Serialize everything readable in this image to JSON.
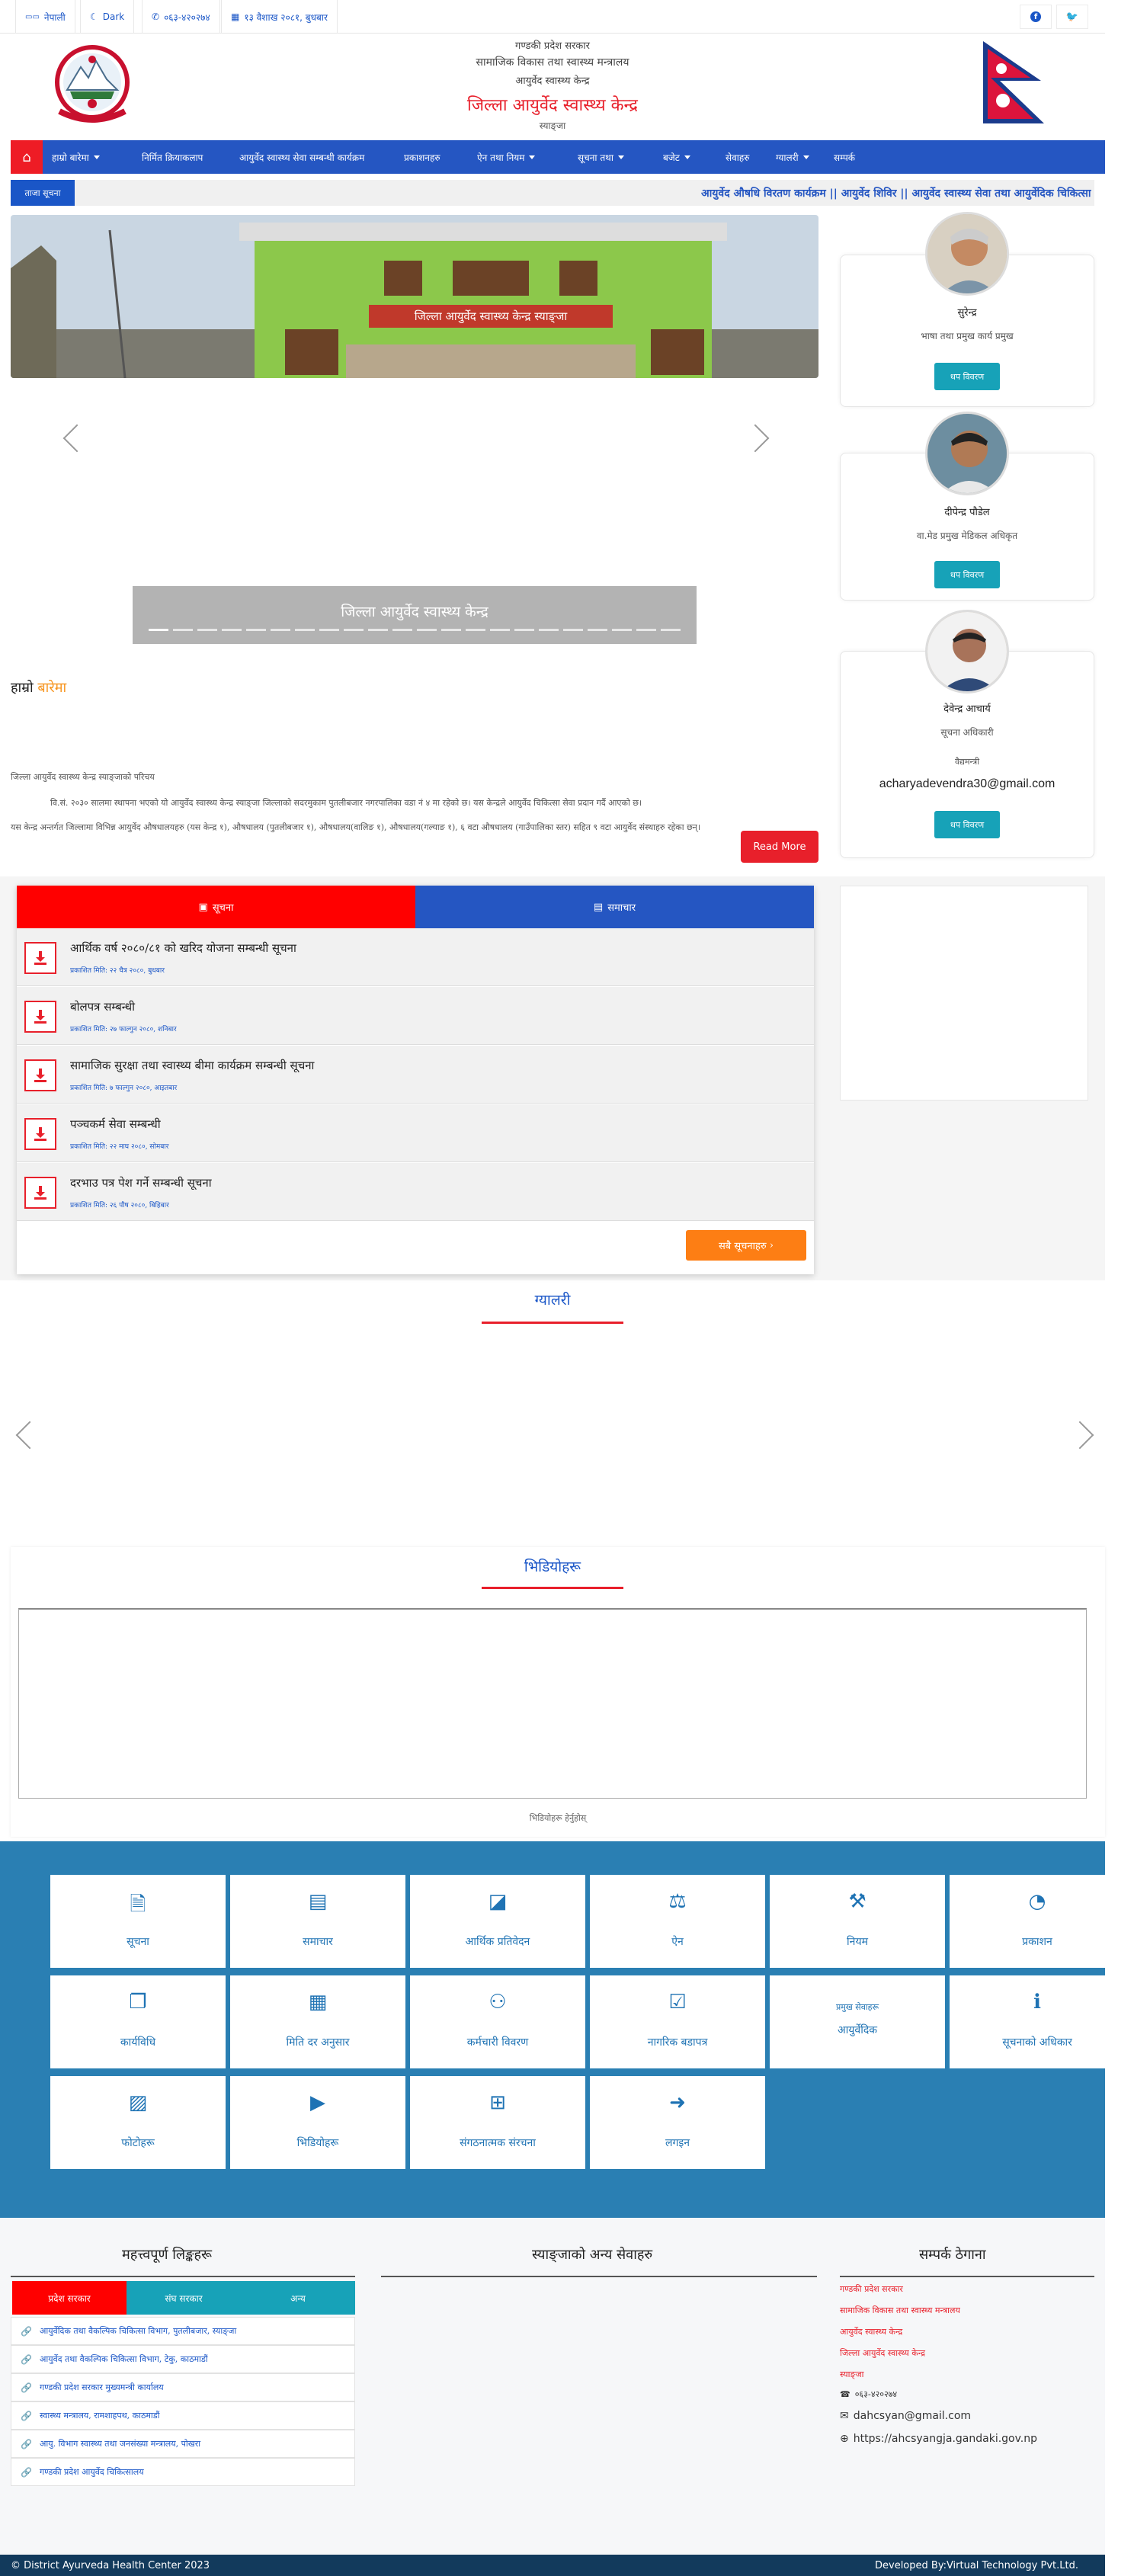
{
  "topbar": {
    "lang_label": "नेपाली",
    "dark_label": "Dark",
    "phone": "०६३-४२०२७४",
    "date": "१३ वैशाख २०८१, बुधबार"
  },
  "header": {
    "line1": "गण्डकी प्रदेश सरकार",
    "line2": "सामाजिक विकास तथा स्वास्थ्य मन्त्रालय",
    "line3": "आयुर्वेद स्वास्थ्य केन्द्र",
    "line4": "जिल्ला आयुर्वेद स्वास्थ्य केन्द्र",
    "line5": "स्याङ्जा"
  },
  "nav": {
    "items": [
      {
        "label": "हाम्रो बारेमा",
        "dropdown": true
      },
      {
        "label": "निर्मित क्रियाकलाप",
        "dropdown": false
      },
      {
        "label": "आयुर्वेद स्वास्थ्य सेवा सम्बन्धी कार्यक्रम",
        "dropdown": false
      },
      {
        "label": "प्रकाशनहरु",
        "dropdown": false
      },
      {
        "label": "ऐन तथा नियम",
        "dropdown": true
      },
      {
        "label": "सूचना तथा",
        "dropdown": true
      },
      {
        "label": "बजेट",
        "dropdown": true
      },
      {
        "label": "सेवाहरु",
        "dropdown": false
      },
      {
        "label": "ग्यालरी",
        "dropdown": true
      },
      {
        "label": "सम्पर्क",
        "dropdown": false
      }
    ]
  },
  "ticker": {
    "label": "ताजा सूचना",
    "text": "आयुर्वेद औषधि विरतण कार्यक्रम || आयुर्वेद शिविर || आयुर्वेद स्वास्थ्य सेवा तथा आयुर्वेदिक चिकित्सा"
  },
  "slider": {
    "caption": "जिल्ला आयुर्वेद स्वास्थ्य केन्द्र",
    "building_sign": "जिल्ला आयुर्वेद स्वास्थ्य केन्द्र स्याङ्जा",
    "dot_count": 22,
    "active_dot": 0
  },
  "about": {
    "title_plain": "हाम्रो",
    "title_highlight": "बारेमा",
    "heading": "जिल्ला आयुर्वेद स्वास्थ्य केन्द्र स्याङ्जाको परिचय",
    "para1": "वि.सं. २०३० सालमा स्थापना भएको यो आयुर्वेद स्वास्थ्य केन्द्र स्याङ्जा जिल्लाको सदरमुकाम पुतलीबजार नगरपालिका वडा नं ४ मा रहेको छ। यस केन्द्रले आयुर्वेद चिकित्सा सेवा प्रदान गर्दै आएको छ।",
    "para2": "यस केन्द्र अन्तर्गत जिल्लामा विभिन्न आयुर्वेद औषधालयहरु (यस केन्द्र १), औषधालय (पुतलीबजार १), औषधालय(वालिङ १), औषधालय(गल्याङ १), ६ वटा औषधालय (गाउँपालिका स्तर) सहित ९ वटा आयुर्वेद संस्थाहरु रहेका छन्।",
    "read_more": "Read More"
  },
  "profiles": [
    {
      "name": "सुरेन्द्र",
      "role": "भाषा तथा प्रमुख कार्य प्रमुख",
      "email": "",
      "button": "थप विवरण"
    },
    {
      "name": "दीपेन्द्र पौडेल",
      "role": "वा.मेड प्रमुख मेडिकल अधिकृत",
      "email": "",
      "button": "थप विवरण"
    },
    {
      "name": "देवेन्द्र आचार्य",
      "role": "सूचना अधिकारी",
      "subrole": "वैद्यमन्त्री",
      "email": "acharyadevendra30@gmail.com",
      "button": "थप विवरण"
    }
  ],
  "notices": {
    "tab_notices": "सूचना",
    "tab_news": "समाचार",
    "items": [
      {
        "title": "आर्थिक वर्ष २०८०/८१ को खरिद योजना सम्बन्धी सूचना",
        "date": "प्रकाशित मिति: २२ चैत्र २०८०, बुधबार"
      },
      {
        "title": "बोलपत्र सम्बन्धी",
        "date": "प्रकाशित मिति: २७ फाल्गुन २०८०, शनिबार"
      },
      {
        "title": "सामाजिक सुरक्षा तथा स्वास्थ्य बीमा कार्यक्रम सम्बन्धी सूचना",
        "date": "प्रकाशित मिति: ७ फाल्गुन २०८०, आइतबार"
      },
      {
        "title": "पञ्चकर्म सेवा सम्बन्धी",
        "date": "प्रकाशित मिति: २२ माघ २०८०, सोमबार"
      },
      {
        "title": "दरभाउ पत्र पेश गर्ने सम्बन्धी सूचना",
        "date": "प्रकाशित मिति: २६ पौष २०८०, बिहिबार"
      }
    ],
    "view_all": "सबै सूचनाहरु"
  },
  "gallery": {
    "title": "ग्यालरी"
  },
  "video": {
    "title": "भिडियोहरू",
    "more": "भिडियोहरू हेर्नुहोस्"
  },
  "services": [
    {
      "icon": "document-icon",
      "label": "सूचना"
    },
    {
      "icon": "news-icon",
      "label": "समाचार"
    },
    {
      "icon": "note-icon",
      "label": "आर्थिक प्रतिवेदन"
    },
    {
      "icon": "scale-icon",
      "label": "ऐन"
    },
    {
      "icon": "gavel-icon",
      "label": "नियम"
    },
    {
      "icon": "rss-icon",
      "label": "प्रकाशन"
    },
    {
      "icon": "copy-icon",
      "label": "कार्यविधि"
    },
    {
      "icon": "file-icon",
      "label": "मिति दर अनुसार"
    },
    {
      "icon": "users-icon",
      "label": "कर्मचारी विवरण"
    },
    {
      "icon": "checklist-icon",
      "label": "नागरिक बडापत्र"
    },
    {
      "icon": "none",
      "label": "आयुर्वेदिक",
      "top": "प्रमुख सेवाहरू"
    },
    {
      "icon": "info-icon",
      "label": "सूचनाको अधिकार"
    },
    {
      "icon": "image-icon",
      "label": "फोटोहरू"
    },
    {
      "icon": "video-icon",
      "label": "भिडियोहरू"
    },
    {
      "icon": "sitemap-icon",
      "label": "संगठनात्मक संरचना"
    },
    {
      "icon": "login-icon",
      "label": "लगइन"
    }
  ],
  "footer": {
    "links_title": "महत्त्वपूर्ण लिङ्कहरू",
    "middle_title": "स्याङ्जाको अन्य सेवाहरु",
    "contact_title": "सम्पर्क ठेगाना",
    "tabs": [
      "प्रदेश सरकार",
      "संघ सरकार",
      "अन्य"
    ],
    "links": [
      "आयुर्वेदिक तथा वैकल्पिक चिकित्सा विभाग, पुतलीबजार, स्याङ्जा",
      "आयुर्वेद तथा वैकल्पिक चिकित्सा विभाग, टेकु, काठमाडौं",
      "गण्डकी प्रदेश सरकार मुख्यमन्त्री कार्यालय",
      "स्वास्थ्य मन्त्रालय, रामशाहपथ, काठमाडौं",
      "आयु. विभाग स्वास्थ्य तथा जनसंख्या मन्त्रालय, पोखरा",
      "गण्डकी प्रदेश आयुर्वेद चिकित्सालय"
    ],
    "contact_lines": [
      "गण्डकी प्रदेश सरकार",
      "सामाजिक विकास तथा स्वास्थ्य मन्त्रालय",
      "आयुर्वेद स्वास्थ्य केन्द्र",
      "जिल्ला आयुर्वेद स्वास्थ्य केन्द्र",
      "स्याङ्जा"
    ],
    "phone": "०६३-४२०२७४",
    "email": "dahcsyan@gmail.com",
    "website": "https://ahcsyangja.gandaki.gov.np"
  },
  "bottom": {
    "copyright": "© District Ayurveda Health Center 2023",
    "developer": "Developed By:Virtual Technology Pvt.Ltd."
  }
}
